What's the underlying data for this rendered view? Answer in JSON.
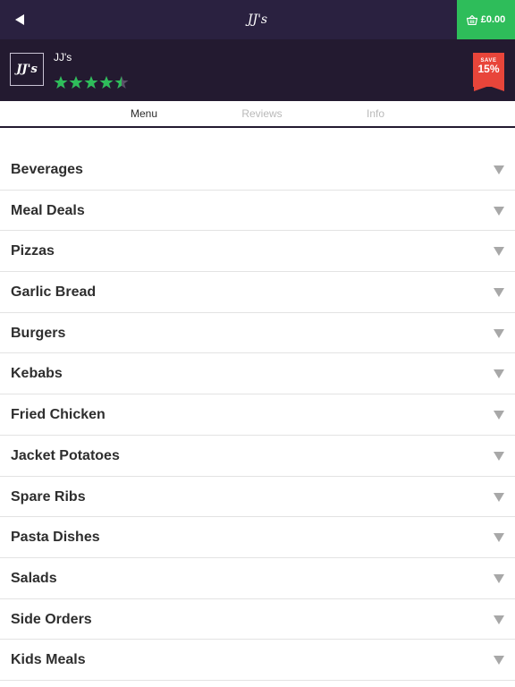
{
  "topbar": {
    "title": "JJ's",
    "back_icon": "back-triangle-icon",
    "cart_icon": "basket-icon",
    "cart_total": "£0.00",
    "cart_color": "#2ebd5a",
    "bar_color": "#2a2140"
  },
  "restaurant": {
    "logo_text": "JJ's",
    "name": "JJ's",
    "rating": 4.5,
    "rating_max": 5,
    "star_color": "#2ebd5a",
    "save_label": "SAVE",
    "save_percent": "15%",
    "save_color": "#e8453a"
  },
  "tabs": [
    {
      "label": "Menu",
      "active": true
    },
    {
      "label": "Reviews",
      "active": false
    },
    {
      "label": "Info",
      "active": false
    }
  ],
  "menu": {
    "categories": [
      {
        "label": "Beverages"
      },
      {
        "label": "Meal Deals"
      },
      {
        "label": "Pizzas"
      },
      {
        "label": "Garlic Bread"
      },
      {
        "label": "Burgers"
      },
      {
        "label": "Kebabs"
      },
      {
        "label": "Fried Chicken"
      },
      {
        "label": "Jacket Potatoes"
      },
      {
        "label": "Spare Ribs"
      },
      {
        "label": "Pasta Dishes"
      },
      {
        "label": "Salads"
      },
      {
        "label": "Side Orders"
      },
      {
        "label": "Kids Meals"
      }
    ],
    "expand_icon": "chevron-down-icon"
  }
}
